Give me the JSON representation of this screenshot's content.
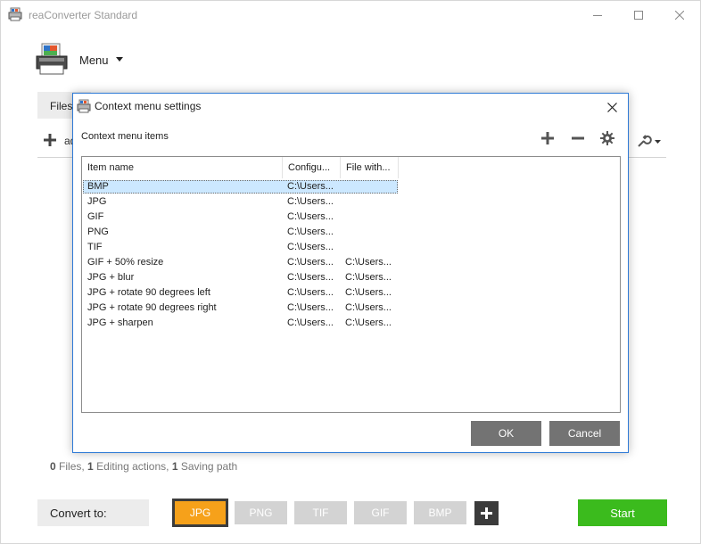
{
  "window": {
    "title": "reaConverter Standard",
    "icons": {
      "app": "printer-app-icon",
      "minimize": "minimize-icon",
      "maximize": "maximize-icon",
      "close": "close-icon"
    }
  },
  "menu": {
    "label": "Menu",
    "icon": "app-logo-icon",
    "caret": "chevron-down-icon"
  },
  "tabs": {
    "files": "Files"
  },
  "toolbar": {
    "add_label": "ad"
  },
  "status": {
    "files_count": "0",
    "files_label": "Files,",
    "editing_count": "1",
    "editing_label": "Editing actions,",
    "saving_count": "1",
    "saving_label": "Saving path"
  },
  "convert": {
    "label": "Convert to:",
    "formats": [
      "JPG",
      "PNG",
      "TIF",
      "GIF",
      "BMP"
    ],
    "selected": "JPG",
    "start_label": "Start",
    "colors": {
      "selected": "#f6a11a",
      "inactive": "#d3d3d3",
      "start": "#3bbb1d"
    }
  },
  "dialog": {
    "title": "Context menu settings",
    "section_label": "Context menu items",
    "columns": [
      "Item name",
      "Configu...",
      "File with..."
    ],
    "rows": [
      {
        "name": "BMP",
        "config": "C:\\Users...",
        "file": ""
      },
      {
        "name": "JPG",
        "config": "C:\\Users...",
        "file": ""
      },
      {
        "name": "GIF",
        "config": "C:\\Users...",
        "file": ""
      },
      {
        "name": "PNG",
        "config": "C:\\Users...",
        "file": ""
      },
      {
        "name": "TIF",
        "config": "C:\\Users...",
        "file": ""
      },
      {
        "name": "GIF + 50% resize",
        "config": "C:\\Users...",
        "file": "C:\\Users..."
      },
      {
        "name": "JPG + blur",
        "config": "C:\\Users...",
        "file": "C:\\Users..."
      },
      {
        "name": "JPG + rotate 90 degrees left",
        "config": "C:\\Users...",
        "file": "C:\\Users..."
      },
      {
        "name": "JPG + rotate 90 degrees right",
        "config": "C:\\Users...",
        "file": "C:\\Users..."
      },
      {
        "name": "JPG + sharpen",
        "config": "C:\\Users...",
        "file": "C:\\Users..."
      }
    ],
    "selected_row": "BMP",
    "ok_label": "OK",
    "cancel_label": "Cancel",
    "accent_color": "#2e7ad6"
  }
}
